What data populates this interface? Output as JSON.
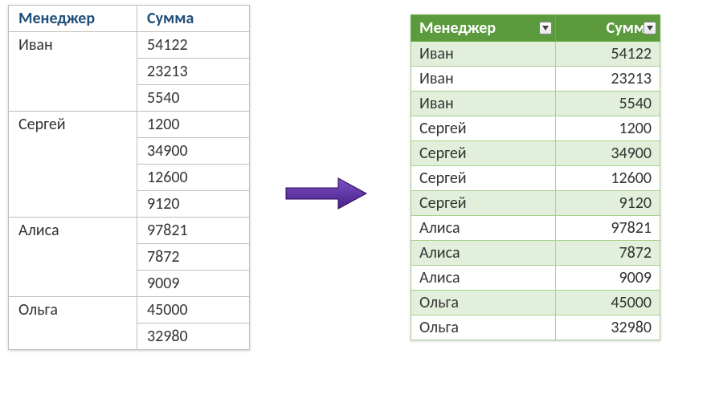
{
  "left_table": {
    "headers": {
      "manager": "Менеджер",
      "sum": "Сумма"
    },
    "rows": [
      {
        "manager": "Иван",
        "sum": "54122",
        "pos": "top"
      },
      {
        "manager": "",
        "sum": "23213",
        "pos": "mid"
      },
      {
        "manager": "",
        "sum": "5540",
        "pos": "bot"
      },
      {
        "manager": "Сергей",
        "sum": "1200",
        "pos": "top"
      },
      {
        "manager": "",
        "sum": "34900",
        "pos": "mid"
      },
      {
        "manager": "",
        "sum": "12600",
        "pos": "mid"
      },
      {
        "manager": "",
        "sum": "9120",
        "pos": "bot"
      },
      {
        "manager": "Алиса",
        "sum": "97821",
        "pos": "top"
      },
      {
        "manager": "",
        "sum": "7872",
        "pos": "mid"
      },
      {
        "manager": "",
        "sum": "9009",
        "pos": "bot"
      },
      {
        "manager": "Ольга",
        "sum": "45000",
        "pos": "top"
      },
      {
        "manager": "",
        "sum": "32980",
        "pos": "bot"
      }
    ]
  },
  "right_table": {
    "headers": {
      "manager": "Менеджер",
      "sum": "Сумма"
    },
    "rows": [
      {
        "manager": "Иван",
        "sum": "54122"
      },
      {
        "manager": "Иван",
        "sum": "23213"
      },
      {
        "manager": "Иван",
        "sum": "5540"
      },
      {
        "manager": "Сергей",
        "sum": "1200"
      },
      {
        "manager": "Сергей",
        "sum": "34900"
      },
      {
        "manager": "Сергей",
        "sum": "12600"
      },
      {
        "manager": "Сергей",
        "sum": "9120"
      },
      {
        "manager": "Алиса",
        "sum": "97821"
      },
      {
        "manager": "Алиса",
        "sum": "7872"
      },
      {
        "manager": "Алиса",
        "sum": "9009"
      },
      {
        "manager": "Ольга",
        "sum": "45000"
      },
      {
        "manager": "Ольга",
        "sum": "32980"
      }
    ]
  },
  "arrow_color": "#5b2c9f"
}
